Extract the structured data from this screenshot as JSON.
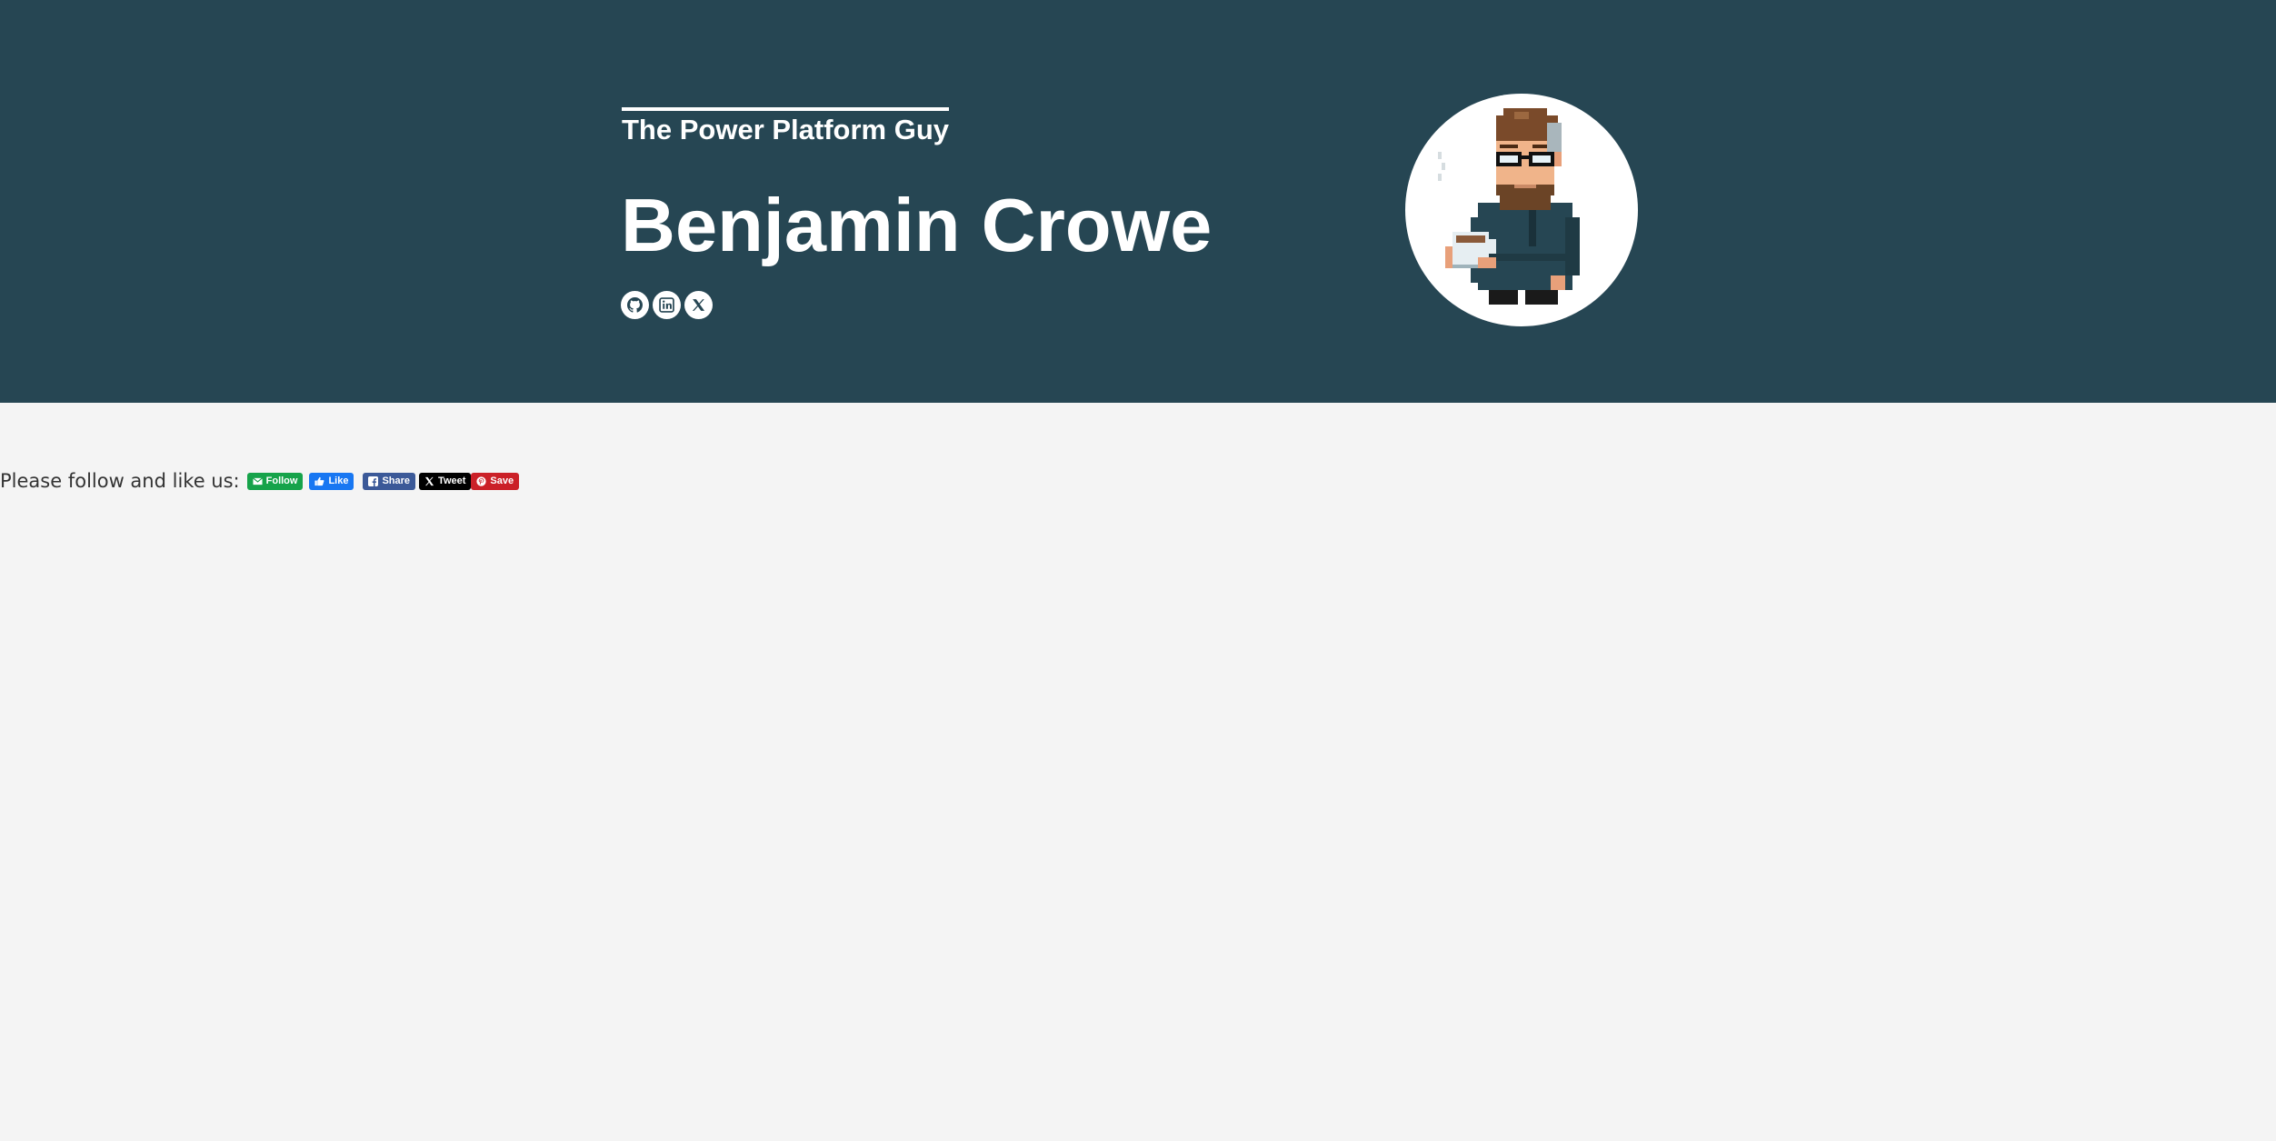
{
  "hero": {
    "tagline": "The Power Platform Guy",
    "name": "Benjamin Crowe",
    "background_color": "#264653",
    "social_links": [
      {
        "name": "github",
        "icon": "github-icon"
      },
      {
        "name": "linkedin",
        "icon": "linkedin-icon"
      },
      {
        "name": "x",
        "icon": "x-icon"
      }
    ],
    "avatar_icon": "pixel-art-avatar-with-coffee"
  },
  "share_bar": {
    "label": "Please follow and like us:",
    "buttons": {
      "follow": "Follow",
      "like": "Like",
      "share": "Share",
      "tweet": "Tweet",
      "save": "Save"
    },
    "colors": {
      "follow": "#16a34a",
      "like": "#1877f2",
      "share": "#3b5998",
      "tweet": "#000000",
      "save": "#cb2027"
    }
  }
}
